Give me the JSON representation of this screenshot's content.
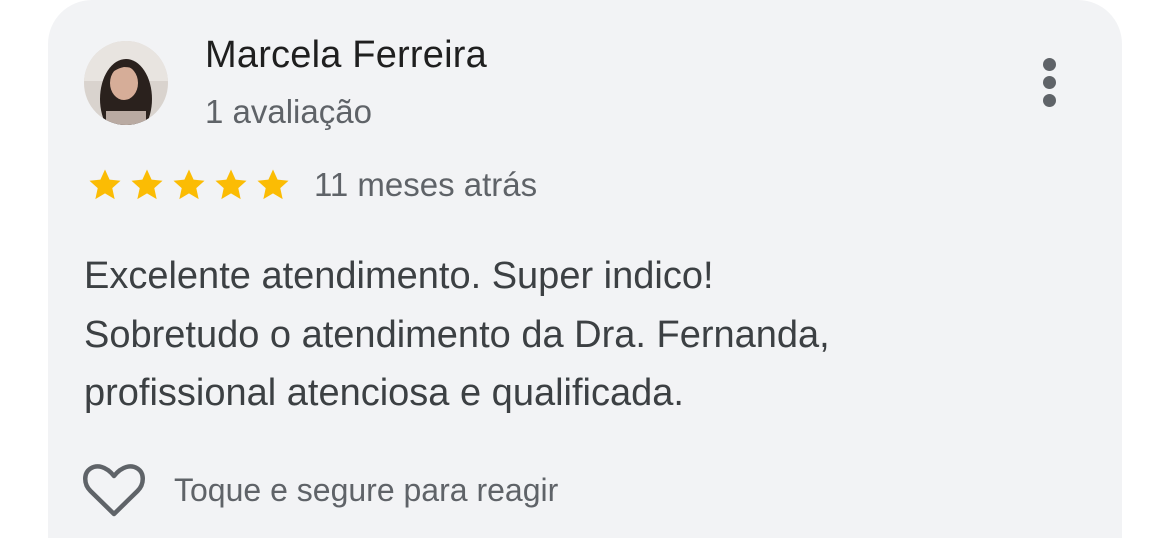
{
  "review": {
    "author_name": "Marcela Ferreira",
    "review_count": "1 avaliação",
    "rating": 5,
    "rating_max": 5,
    "time_ago": "11 meses atrás",
    "text_lines": [
      "Excelente atendimento. Super indico!",
      "Sobretudo o atendimento da Dra. Fernanda,",
      "profissional atenciosa e qualificada."
    ],
    "react_hint": "Toque e segure para reagir"
  },
  "icons": {
    "more": "more-vert-icon",
    "heart": "heart-outline-icon",
    "star": "star-icon"
  },
  "colors": {
    "star": "#fbbc04",
    "card_background": "#f2f3f5",
    "secondary_text": "#5f6368",
    "primary_text": "#1f1f1f"
  }
}
